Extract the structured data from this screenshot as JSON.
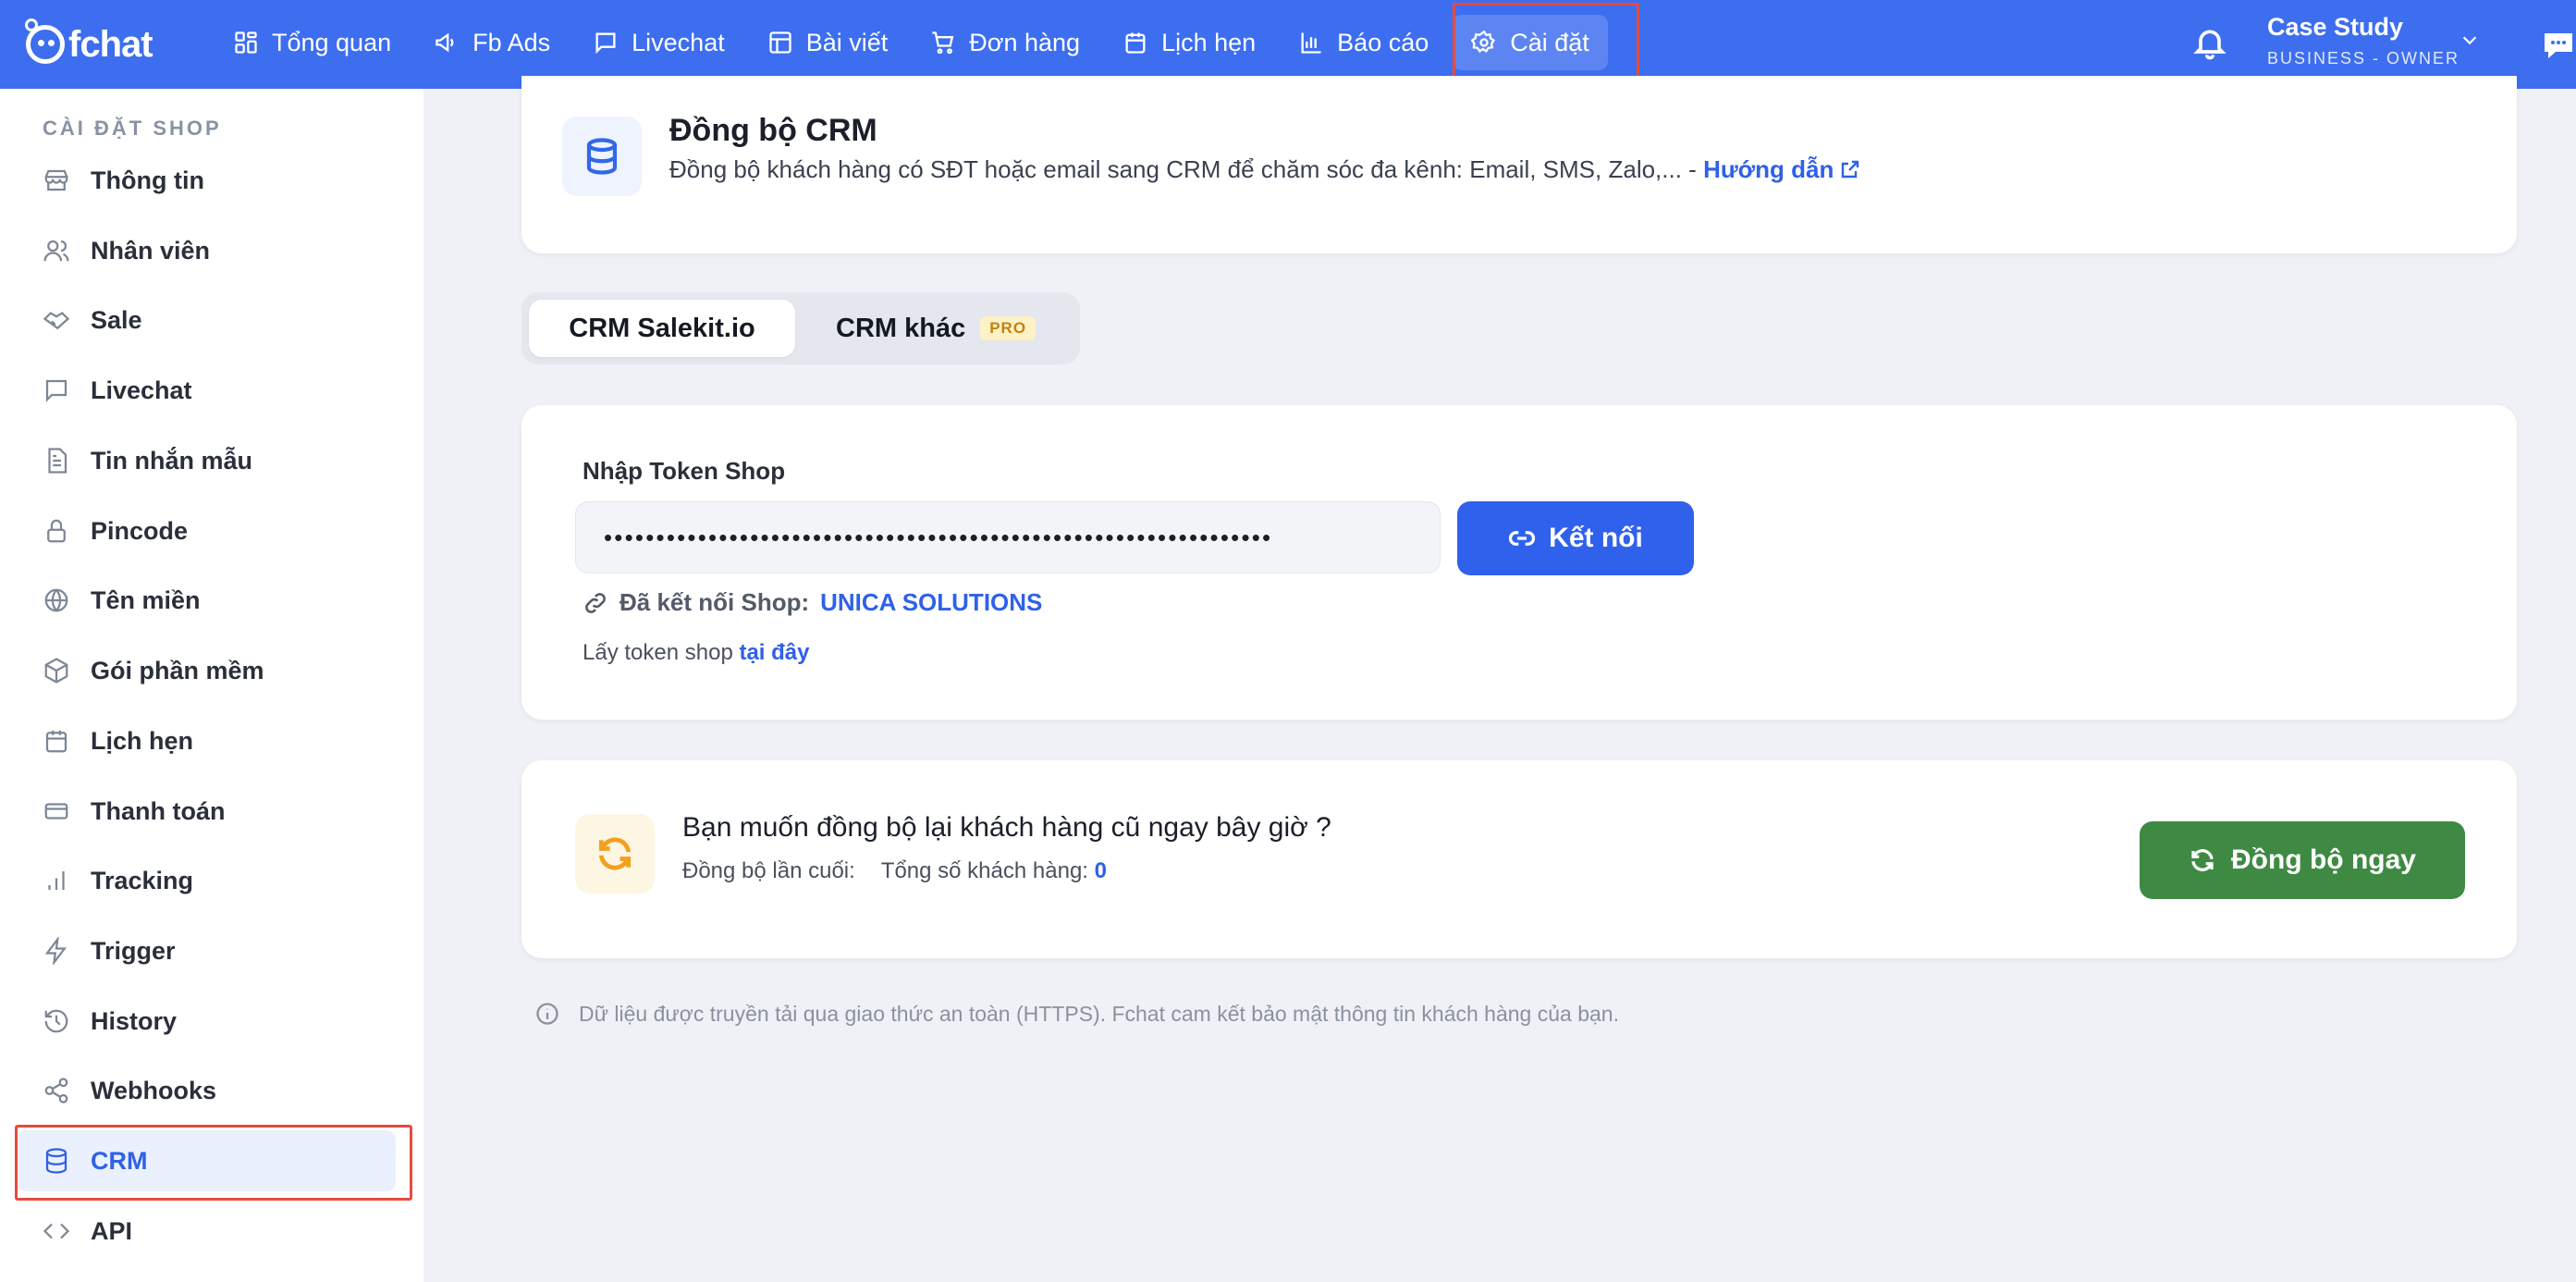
{
  "app": {
    "logo_text": "fchat"
  },
  "nav": {
    "items": [
      {
        "label": "Tổng quan",
        "icon": "dashboard-icon"
      },
      {
        "label": "Fb Ads",
        "icon": "megaphone-icon"
      },
      {
        "label": "Livechat",
        "icon": "chat-icon"
      },
      {
        "label": "Bài viết",
        "icon": "layout-icon"
      },
      {
        "label": "Đơn hàng",
        "icon": "cart-icon"
      },
      {
        "label": "Lịch hẹn",
        "icon": "calendar-icon"
      },
      {
        "label": "Báo cáo",
        "icon": "bar-chart-icon"
      },
      {
        "label": "Cài đặt",
        "icon": "gear-icon",
        "active": true
      }
    ]
  },
  "user": {
    "name": "Case Study",
    "role": "BUSINESS - OWNER"
  },
  "sidebar": {
    "heading": "CÀI ĐẶT SHOP",
    "items": [
      {
        "label": "Thông tin",
        "icon": "store-icon"
      },
      {
        "label": "Nhân viên",
        "icon": "users-icon"
      },
      {
        "label": "Sale",
        "icon": "handshake-icon"
      },
      {
        "label": "Livechat",
        "icon": "message-icon"
      },
      {
        "label": "Tin nhắn mẫu",
        "icon": "document-icon"
      },
      {
        "label": "Pincode",
        "icon": "lock-icon"
      },
      {
        "label": "Tên miền",
        "icon": "globe-icon"
      },
      {
        "label": "Gói phần mềm",
        "icon": "package-icon"
      },
      {
        "label": "Lịch hẹn",
        "icon": "calendar-icon"
      },
      {
        "label": "Thanh toán",
        "icon": "credit-card-icon"
      },
      {
        "label": "Tracking",
        "icon": "signal-icon"
      },
      {
        "label": "Trigger",
        "icon": "bolt-icon"
      },
      {
        "label": "History",
        "icon": "history-icon"
      },
      {
        "label": "Webhooks",
        "icon": "share-icon"
      },
      {
        "label": "CRM",
        "icon": "database-icon",
        "active": true
      },
      {
        "label": "API",
        "icon": "code-icon"
      }
    ]
  },
  "header": {
    "title": "Đồng bộ CRM",
    "description": "Đồng bộ khách hàng có SĐT hoặc email sang CRM để chăm sóc đa kênh: Email, SMS, Zalo,... - ",
    "guide_link": "Hướng dẫn"
  },
  "tabs": [
    {
      "label": "CRM Salekit.io",
      "active": true
    },
    {
      "label": "CRM khác",
      "badge": "PRO"
    }
  ],
  "token": {
    "label": "Nhập Token Shop",
    "value": "••••••••••••••••••••••••••••••••••••••••••••••••••••••••••••••••",
    "connect_label": "Kết nối",
    "connected_prefix": "Đã kết nối Shop:",
    "shop_name": "UNICA SOLUTIONS",
    "hint_prefix": "Lấy token shop ",
    "hint_link": "tại đây"
  },
  "sync": {
    "title": "Bạn muốn đồng bộ lại khách hàng cũ ngay bây giờ ?",
    "last_sync_label": "Đồng bộ lần cuối:",
    "total_label": "Tổng số khách hàng:",
    "total_value": "0",
    "button_label": "Đồng bộ ngay"
  },
  "footnote": "Dữ liệu được truyền tải qua giao thức an toàn (HTTPS). Fchat cam kết bảo mật thông tin khách hàng của bạn.",
  "colors": {
    "topbar": "#3d6ef0",
    "primary": "#2f61ec",
    "success": "#3f8a43",
    "highlight_frame": "#e54b3f"
  }
}
